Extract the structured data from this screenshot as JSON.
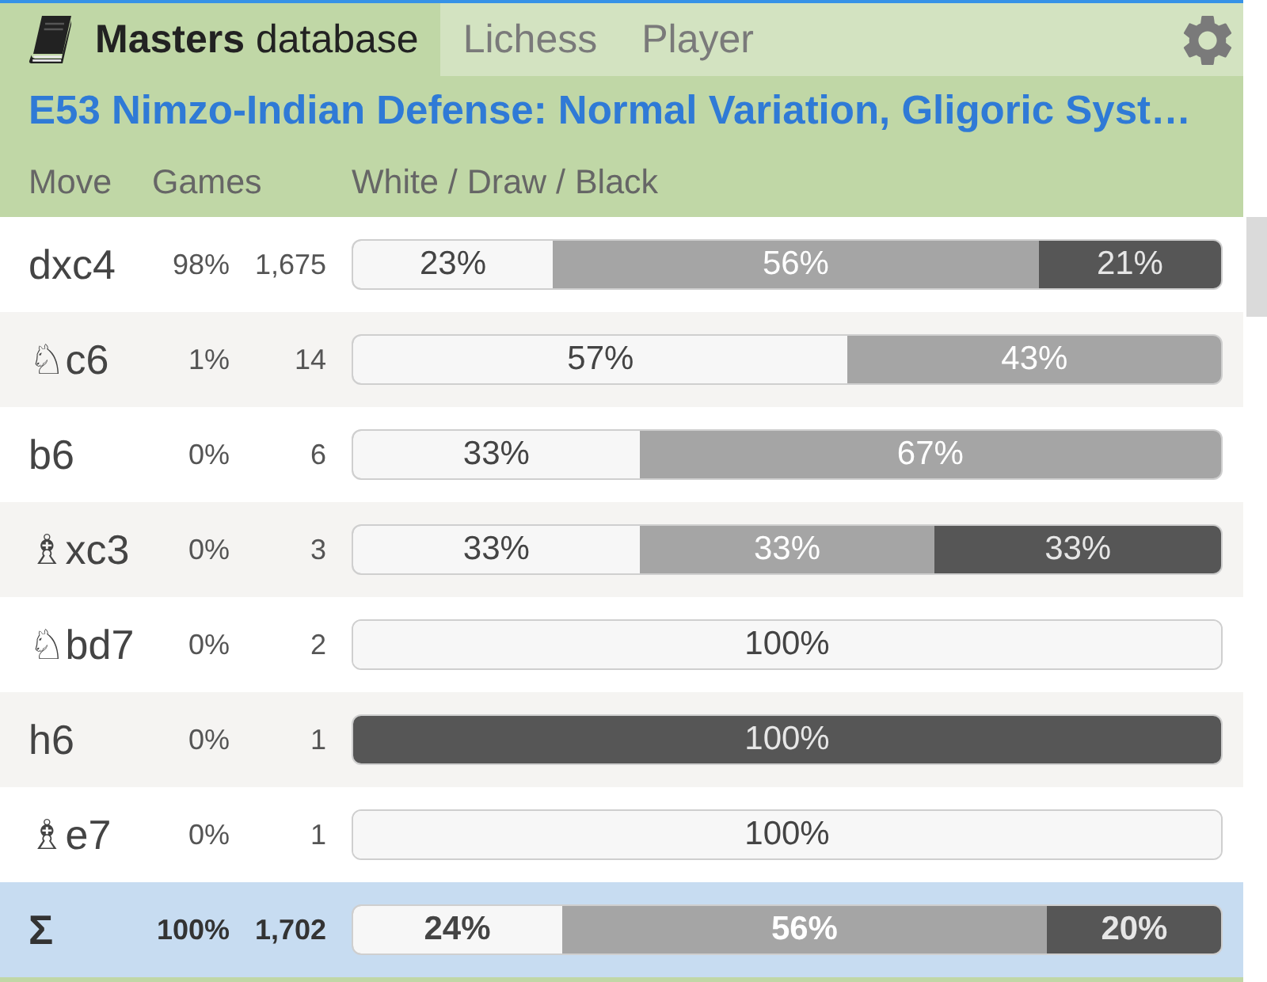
{
  "tabs": [
    {
      "label": "**Masters** database",
      "selected": true
    },
    {
      "label": "Lichess",
      "selected": false
    },
    {
      "label": "Player",
      "selected": false
    }
  ],
  "opening": {
    "name": "E53 Nimzo-Indian Defense: Normal Variation, Gligoric Syst…"
  },
  "table": {
    "columns": [
      "Move",
      "Games",
      "White / Draw / Black"
    ],
    "rows": [
      {
        "move": "dxc4",
        "share": "98%",
        "games": "1,675",
        "results": [
          {
            "kind": "white",
            "level": 0.23,
            "label": "23%"
          },
          {
            "kind": "draw",
            "label": "56%"
          },
          {
            "kind": "black",
            "level": 0.21,
            "label": "21%"
          }
        ]
      },
      {
        "move": "♘c6",
        "share": "1%",
        "games": "14",
        "results": [
          {
            "kind": "white",
            "level": 0.57,
            "label": "57%"
          },
          {
            "kind": "draw",
            "label": "43%"
          }
        ]
      },
      {
        "move": "b6",
        "share": "0%",
        "games": "6",
        "results": [
          {
            "kind": "white",
            "level": 0.33,
            "label": "33%"
          },
          {
            "kind": "draw",
            "label": "67%"
          }
        ]
      },
      {
        "move": "♗xc3",
        "share": "0%",
        "games": "3",
        "results": [
          {
            "kind": "white",
            "level": 0.33,
            "label": "33%"
          },
          {
            "kind": "draw",
            "label": "33%"
          },
          {
            "kind": "black",
            "level": 0.33,
            "label": "33%"
          }
        ]
      },
      {
        "move": "♘bd7",
        "share": "0%",
        "games": "2",
        "results": [
          {
            "kind": "white",
            "level": 1,
            "label": "100%"
          }
        ]
      },
      {
        "move": "h6",
        "share": "0%",
        "games": "1",
        "results": [
          {
            "kind": "black",
            "level": 1,
            "label": "100%"
          }
        ]
      },
      {
        "move": "♗e7",
        "share": "0%",
        "games": "1",
        "results": [
          {
            "kind": "white",
            "level": 1,
            "label": "100%"
          }
        ]
      }
    ],
    "total": {
      "move": "Σ",
      "share": "100%",
      "games": "1,702",
      "results": [
        {
          "kind": "white",
          "level": 0.24,
          "label": "24%"
        },
        {
          "kind": "draw",
          "label": "56%"
        },
        {
          "kind": "black",
          "level": 0.2,
          "label": "20%"
        }
      ]
    }
  }
}
